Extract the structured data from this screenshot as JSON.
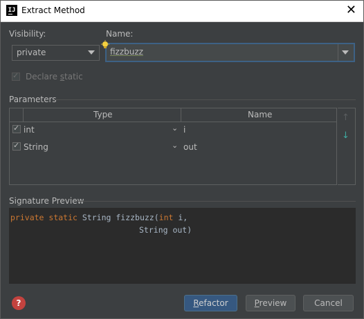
{
  "window": {
    "title": "Extract Method",
    "app_icon_text": "IJ"
  },
  "visibility": {
    "label": "Visibility:",
    "selected": "private"
  },
  "name": {
    "label": "Name:",
    "value": "fizzbuzz"
  },
  "declare_static": {
    "label_before": "Declare ",
    "label_mnemonic": "s",
    "label_after": "tatic",
    "checked": true,
    "enabled": false
  },
  "parameters": {
    "title": "Parameters",
    "columns": {
      "type": "Type",
      "name": "Name"
    },
    "rows": [
      {
        "checked": true,
        "type": "int",
        "name": "i"
      },
      {
        "checked": true,
        "type": "String",
        "name": "out"
      }
    ]
  },
  "signature_preview": {
    "title": "Signature Preview",
    "line1": {
      "kw1": "private",
      "kw2": "static",
      "rest1": " String fizzbuzz(",
      "kw3": "int",
      "rest2": " i,"
    },
    "line2": "String out)"
  },
  "buttons": {
    "refactor_mn": "R",
    "refactor_rest": "efactor",
    "preview_mn": "P",
    "preview_rest": "review",
    "cancel": "Cancel",
    "help": "?"
  },
  "colors": {
    "keyword": "#cc7832",
    "primary_button": "#365880",
    "help": "#c3433f",
    "down_arrow": "#3fa9a0"
  }
}
